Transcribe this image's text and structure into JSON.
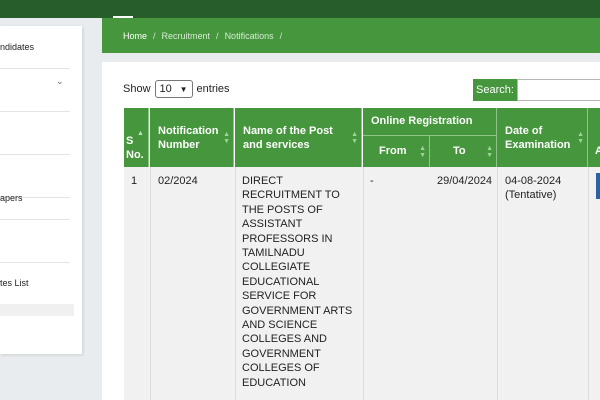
{
  "sidebar": {
    "items": [
      {
        "label": "ndidates"
      },
      {
        "label": ""
      },
      {
        "label": ""
      },
      {
        "label": ""
      },
      {
        "label": "apers"
      },
      {
        "label": ""
      },
      {
        "label": "tes List"
      }
    ]
  },
  "breadcrumb": {
    "home": "Home",
    "recruitment": "Recruitment",
    "notifications": "Notifications",
    "separator": "/"
  },
  "controls": {
    "show_label": "Show",
    "entries_value": "10",
    "entries_label": "entries",
    "search_label": "Search:",
    "search_value": ""
  },
  "table": {
    "headers": {
      "sno": "S No.",
      "notification_number": "Notification Number",
      "post_name": "Name of the Post and services",
      "online_registration": "Online Registration",
      "from": "From",
      "to": "To",
      "exam_date": "Date of Examination",
      "action": "A"
    },
    "rows": [
      {
        "sno": "1",
        "notification_number": "02/2024",
        "post_name": "DIRECT RECRUITMENT TO THE POSTS OF ASSISTANT PROFESSORS IN TAMILNADU COLLEGIATE EDUCATIONAL SERVICE FOR GOVERNMENT ARTS AND SCIENCE COLLEGES AND GOVERNMENT COLLEGES OF EDUCATION",
        "from": "-",
        "to": "29/04/2024",
        "exam_date": "04-08-2024 (Tentative)"
      }
    ]
  },
  "colors": {
    "header_green": "#45963c",
    "top_bar": "#275d2a",
    "action_blue": "#2a62a8"
  }
}
